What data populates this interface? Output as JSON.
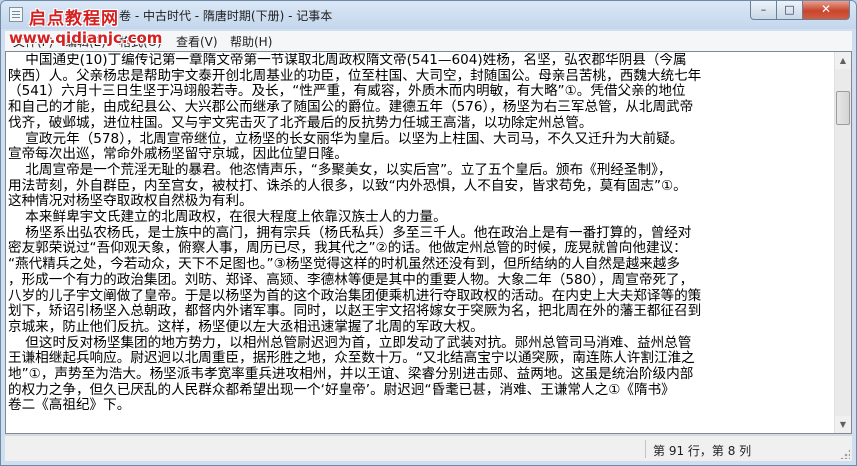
{
  "window": {
    "title": "卷 - 中古时代 - 隋唐时期(下册) - 记事本",
    "controls": {
      "minimize": "–",
      "maximize": "□",
      "close": "✕"
    }
  },
  "watermark": {
    "title": "启点教程网",
    "url": "www.qidianjc.com"
  },
  "menu": {
    "items": [
      "文件(F)",
      "编辑(E)",
      "格式(O)",
      "查看(V)",
      "帮助(H)"
    ]
  },
  "document": {
    "lines": [
      "    中国通史(10)丁编传记第一章隋文帝第一节谋取北周政权隋文帝(541—604)姓杨，名坚，弘农郡华阴县（今属",
      "陕西）人。父亲杨忠是帮助宇文泰开创北周基业的功臣，位至柱国、大司空，封随国公。母亲吕苦桃，西魏大统七年",
      "（541）六月十三日生坚于冯翊般若寺。及长，“性严重，有威容，外质木而内明敏，有大略”①。凭借父亲的地位",
      "和自己的才能，由成纪县公、大兴郡公而继承了随国公的爵位。建德五年（576），杨坚为右三军总管，从北周武帝",
      "伐齐，破邺城，进位柱国。又与宇文宪击灭了北齐最后的反抗势力任城王高湝，以功除定州总管。",
      "    宣政元年（578），北周宣帝继位，立杨坚的长女丽华为皇后。以坚为上柱国、大司马，不久又迁升为大前疑。",
      "宣帝每次出巡，常命外戚杨坚留守京城，因此位望日隆。",
      "    北周宣帝是一个荒淫无耻的暴君。他恣情声乐，“多聚美女，以实后宫”。立了五个皇后。颁布《刑经圣制》，",
      "用法苛刻，外自群臣，内至宫女，被杖打、诛杀的人很多，以致“内外恐惧，人不自安，皆求苟免，莫有固志”①。",
      "这种情况对杨坚夺取政权自然极为有利。",
      "    本来鲜卑宇文氏建立的北周政权，在很大程度上依靠汉族士人的力量。",
      "    杨坚系出弘农杨氏，是士族中的高门，拥有宗兵（杨氏私兵）多至三千人。他在政治上是有一番打算的，曾经对",
      "密友郭荣说过“吾仰观天象，俯察人事，周历已尽，我其代之”②的话。他做定州总管的时候，庞晃就曾向他建议：",
      "“燕代精兵之处，今若动众，天下不足图也。”③杨坚觉得这样的时机虽然还没有到，但所结纳的人自然是越来越多",
      "，形成一个有力的政治集团。刘昉、郑译、高颎、李德林等便是其中的重要人物。大象二年（580），周宣帝死了，",
      "八岁的儿子宇文阐做了皇帝。于是以杨坚为首的这个政治集团便乘机进行夺取政权的活动。在内史上大夫郑译等的策",
      "划下，矫诏引杨坚入总朝政，都督内外诸军事。同时，以赵王宇文招将嫁女于突厥为名，把北周在外的藩王都征召到",
      "京城来，防止他们反抗。这样，杨坚便以左大丞相迅速掌握了北周的军政大权。",
      "    但这时反对杨坚集团的地方势力，以相州总管尉迟迥为首，立即发动了武装对抗。郧州总管司马消难、益州总管",
      "王谦相继起兵响应。尉迟迥以北周重臣，据形胜之地，众至数十万。“又北结高宝宁以通突厥，南连陈人许割江淮之",
      "地”①，声势至为浩大。杨坚派韦孝宽率重兵进攻相州，并以王谊、梁睿分别进击郧、益两地。这虽是统治阶级内部",
      "的权力之争，但久已厌乱的人民群众都希望出现一个‘好皇帝’。尉迟迥“昏耄已甚，消难、王谦常人之①《隋书》",
      "卷二《高祖纪》下。"
    ]
  },
  "scrollbar": {
    "up_icon": "▲",
    "down_icon": "▼",
    "position": 0.07
  },
  "status": {
    "position": "第 91 行，第 8 列"
  }
}
